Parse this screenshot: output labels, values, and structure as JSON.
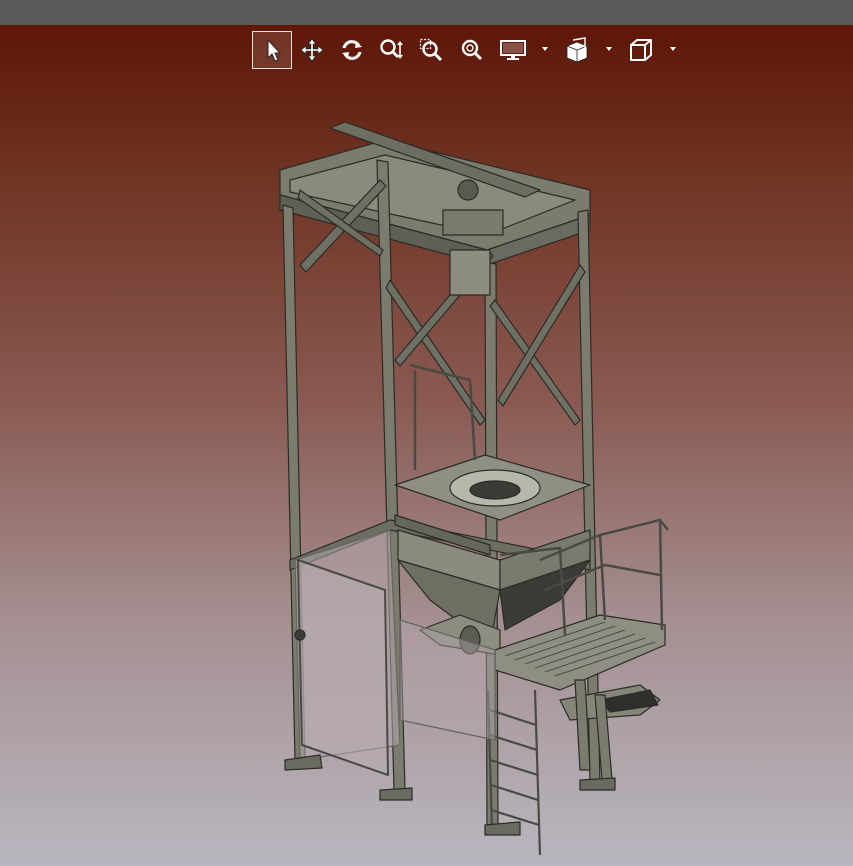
{
  "window": {
    "titlebar_color": "#595959"
  },
  "viewport": {
    "background_top": "#5e1608",
    "background_bottom": "#b9b6bf"
  },
  "toolbar": {
    "items": [
      {
        "id": "select",
        "icon": "cursor-arrow-icon",
        "active": true
      },
      {
        "id": "pan",
        "icon": "move-arrows-icon",
        "active": false
      },
      {
        "id": "rotate",
        "icon": "rotate-icon",
        "active": false
      },
      {
        "id": "zoom",
        "icon": "zoom-in-out-icon",
        "active": false
      },
      {
        "id": "zoom-window",
        "icon": "zoom-window-icon",
        "active": false
      },
      {
        "id": "zoom-fit",
        "icon": "zoom-fit-icon",
        "active": false
      },
      {
        "id": "display-style",
        "icon": "monitor-icon",
        "dropdown": true
      },
      {
        "id": "section-view",
        "icon": "section-cube-icon",
        "dropdown": true
      },
      {
        "id": "standard-views",
        "icon": "cube-view-icon",
        "dropdown": true
      }
    ],
    "icon_color": "#ffffff"
  },
  "model": {
    "description_color": "#7d7e70",
    "edge_color": "#2a2a26"
  }
}
